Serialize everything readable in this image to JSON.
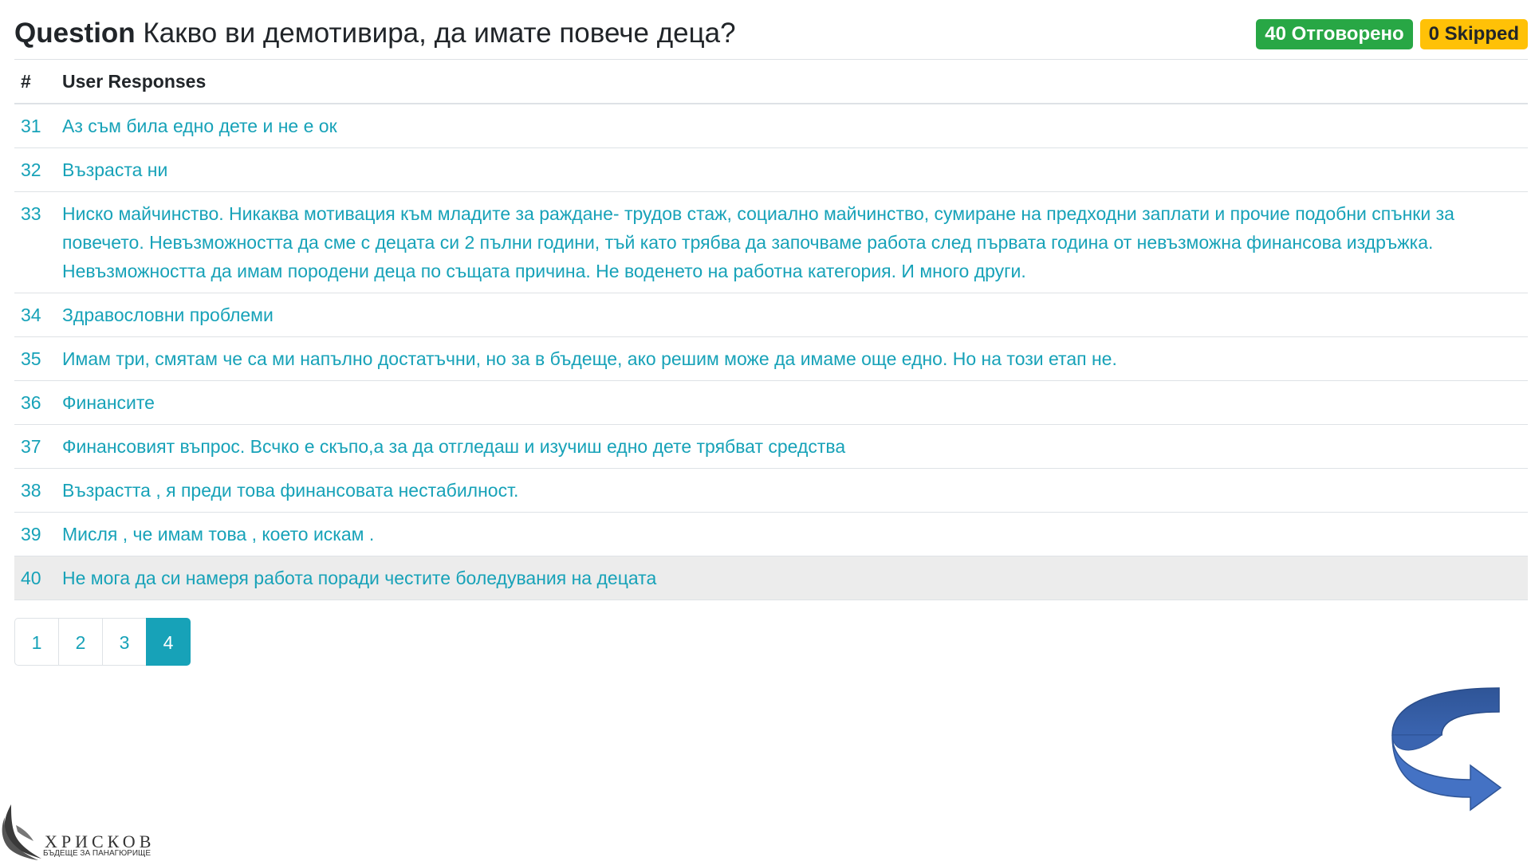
{
  "question": {
    "label": "Question",
    "text": "Какво ви демотивира, да имате повече деца?"
  },
  "badges": {
    "answered": "40 Отговорено",
    "skipped": "0 Skipped"
  },
  "table": {
    "col_num": "#",
    "col_responses": "User Responses",
    "rows": [
      {
        "num": "31",
        "text": "Аз съм била едно дете и не е ок"
      },
      {
        "num": "32",
        "text": "Възраста ни"
      },
      {
        "num": "33",
        "text": "Ниско майчинство. Никаква мотивация към младите за раждане- трудов стаж, социално майчинство, сумиране на предходни заплати и прочие подобни спънки за повечето. Невъзможността да сме с децата си 2 пълни години, тъй като трябва да започваме работа след първата година от невъзможна финансова издръжка. Невъзможността да имам породени деца по същата причина. Не воденето на работна категория. И много други."
      },
      {
        "num": "34",
        "text": "Здравословни проблеми"
      },
      {
        "num": "35",
        "text": "Имам три, смятам че са ми напълно достатъчни, но за в бъдеще, ако решим може да имаме още едно. Но на този етап не."
      },
      {
        "num": "36",
        "text": "Финансите"
      },
      {
        "num": "37",
        "text": "Финансовият въпрос. Всчко е скъпо,а за да отгледаш и изучиш едно дете трябват средства"
      },
      {
        "num": "38",
        "text": "Възрастта , я преди това финансовата нестабилност."
      },
      {
        "num": "39",
        "text": "Мисля , че имам това , което искам ."
      },
      {
        "num": "40",
        "text": "Не мога да си намеря работа поради честите боледувания на децата"
      }
    ]
  },
  "pagination": {
    "pages": [
      "1",
      "2",
      "3",
      "4"
    ],
    "current": "4"
  },
  "logo": {
    "name": "ХРИСКОВ",
    "tagline": "БЪДЕЩЕ ЗА ПАНАГЮРИЩЕ"
  },
  "colors": {
    "accent": "#17a2b8",
    "answered_badge": "#28a745",
    "skipped_badge": "#ffc107",
    "arrow": "#4472c4"
  },
  "icons": {
    "arrow": "curved-arrow-icon",
    "logo": "bird-wing-logo"
  }
}
